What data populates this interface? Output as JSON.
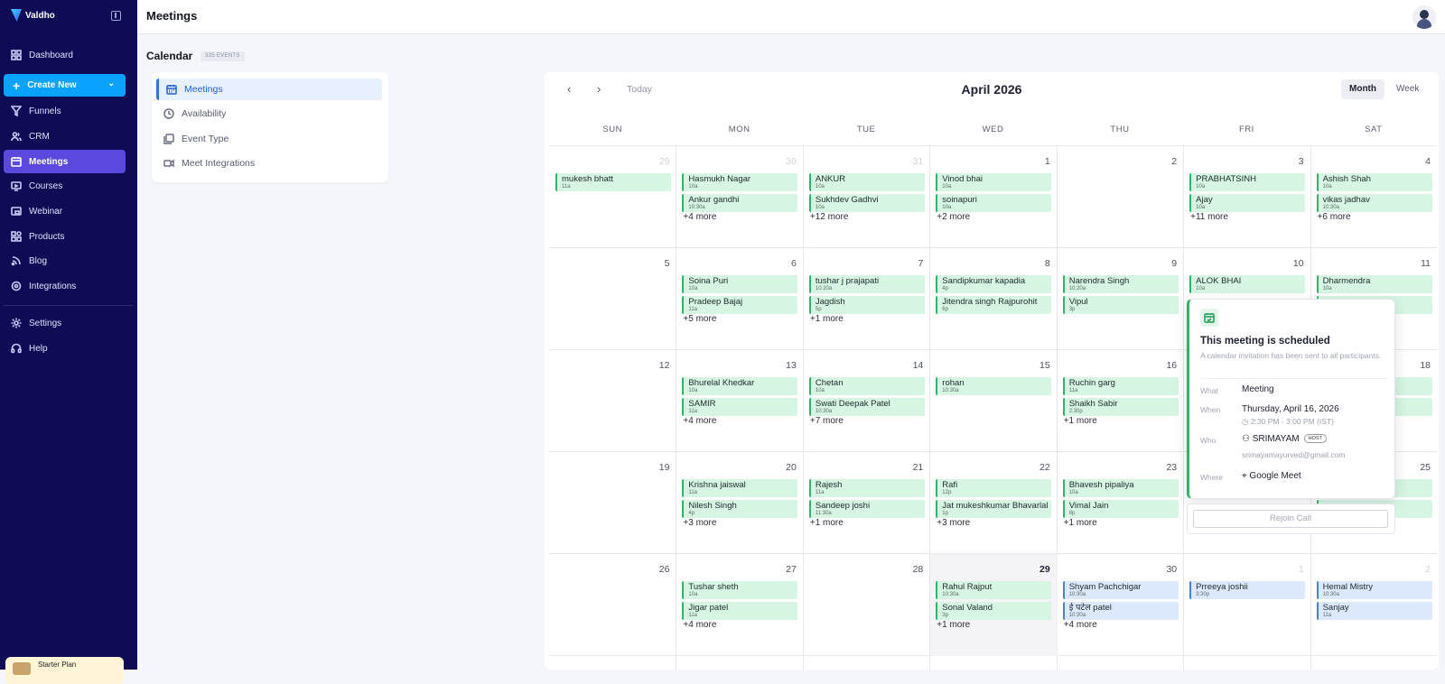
{
  "app": {
    "name": "Valdho"
  },
  "sidebar": {
    "items": [
      {
        "label": "Dashboard",
        "icon": "grid-icon"
      },
      {
        "label": "Funnels",
        "icon": "funnel-icon"
      },
      {
        "label": "CRM",
        "icon": "users-icon"
      },
      {
        "label": "Meetings",
        "icon": "calendar-icon",
        "active": true
      },
      {
        "label": "Courses",
        "icon": "courses-icon"
      },
      {
        "label": "Webinar",
        "icon": "webinar-icon"
      },
      {
        "label": "Products",
        "icon": "products-icon"
      },
      {
        "label": "Blog",
        "icon": "rss-icon"
      },
      {
        "label": "Integrations",
        "icon": "integrations-icon"
      },
      {
        "label": "Settings",
        "icon": "gear-icon"
      },
      {
        "label": "Help",
        "icon": "headset-icon"
      }
    ],
    "create_label": "Create New",
    "promo_label": "Starter Plan"
  },
  "header": {
    "title": "Meetings"
  },
  "calendar_section": {
    "title": "Calendar",
    "badge": "335 EVENTS"
  },
  "subnav": [
    {
      "label": "Meetings",
      "icon": "calendar-icon",
      "active": true
    },
    {
      "label": "Availability",
      "icon": "clock-icon"
    },
    {
      "label": "Event Type",
      "icon": "layers-icon"
    },
    {
      "label": "Meet Integrations",
      "icon": "video-icon"
    }
  ],
  "calendar": {
    "today_label": "Today",
    "month_title": "April 2026",
    "view_month": "Month",
    "view_week": "Week",
    "prev_icon": "chevron-left-icon",
    "next_icon": "chevron-right-icon",
    "days": [
      "SUN",
      "MON",
      "TUE",
      "WED",
      "THU",
      "FRI",
      "SAT"
    ],
    "weeks": [
      [
        {
          "d": "29",
          "m": true,
          "ev": [
            {
              "n": "mukesh bhatt",
              "t": "11a"
            }
          ]
        },
        {
          "d": "30",
          "m": true,
          "ev": [
            {
              "n": "Hasmukh Nagar",
              "t": "10a"
            },
            {
              "n": "Ankur gandhi",
              "t": "10:30a"
            }
          ],
          "more": "+4 more"
        },
        {
          "d": "31",
          "m": true,
          "ev": [
            {
              "n": "ANKUR",
              "t": "10a"
            },
            {
              "n": "Sukhdev Gadhvi",
              "t": "10a"
            }
          ],
          "more": "+12 more"
        },
        {
          "d": "1",
          "ev": [
            {
              "n": "Vinod bhai",
              "t": "10a"
            },
            {
              "n": "soinapuri",
              "t": "10a"
            }
          ],
          "more": "+2 more"
        },
        {
          "d": "2",
          "ev": []
        },
        {
          "d": "3",
          "ev": [
            {
              "n": "PRABHATSINH",
              "t": "10a"
            },
            {
              "n": "Ajay",
              "t": "10a"
            }
          ],
          "more": "+11 more"
        },
        {
          "d": "4",
          "ev": [
            {
              "n": "Ashish Shah",
              "t": "10a"
            },
            {
              "n": "vikas jadhav",
              "t": "10:30a"
            }
          ],
          "more": "+6 more"
        }
      ],
      [
        {
          "d": "5",
          "ev": []
        },
        {
          "d": "6",
          "ev": [
            {
              "n": "Soina Puri",
              "t": "10a"
            },
            {
              "n": "Pradeep Bajaj",
              "t": "11a"
            }
          ],
          "more": "+5 more"
        },
        {
          "d": "7",
          "ev": [
            {
              "n": "tushar j prajapati",
              "t": "10:20a"
            },
            {
              "n": "Jagdish",
              "t": "5p"
            }
          ],
          "more": "+1 more"
        },
        {
          "d": "8",
          "ev": [
            {
              "n": "Sandipkumar kapadia",
              "t": "4p"
            },
            {
              "n": "Jitendra singh Rajpurohit",
              "t": "6p"
            }
          ]
        },
        {
          "d": "9",
          "ev": [
            {
              "n": "Narendra Singh",
              "t": "10:20a"
            },
            {
              "n": "Vipul",
              "t": "3p"
            }
          ]
        },
        {
          "d": "10",
          "ev": [
            {
              "n": "ALOK BHAI",
              "t": "10a"
            }
          ]
        },
        {
          "d": "11",
          "ev": [
            {
              "n": "Dharmendra",
              "t": "10a"
            },
            {
              "n": "",
              "t": ""
            }
          ]
        }
      ],
      [
        {
          "d": "12",
          "ev": []
        },
        {
          "d": "13",
          "ev": [
            {
              "n": "Bhurelal Khedkar",
              "t": "10a"
            },
            {
              "n": "SAMIR",
              "t": "11a"
            }
          ],
          "more": "+4 more"
        },
        {
          "d": "14",
          "ev": [
            {
              "n": "Chetan",
              "t": "10a"
            },
            {
              "n": "Swati Deepak Patel",
              "t": "10:30a"
            }
          ],
          "more": "+7 more"
        },
        {
          "d": "15",
          "ev": [
            {
              "n": "rohan",
              "t": "10:30a"
            }
          ]
        },
        {
          "d": "16",
          "ev": [
            {
              "n": "Ruchin garg",
              "t": "11a"
            },
            {
              "n": "Shaikh Sabir",
              "t": "2:30p"
            }
          ],
          "more": "+1 more"
        },
        {
          "d": "17",
          "ev": []
        },
        {
          "d": "18",
          "ev": [
            {
              "n": "",
              "t": ""
            },
            {
              "n": "",
              "t": ""
            }
          ]
        }
      ],
      [
        {
          "d": "19",
          "ev": []
        },
        {
          "d": "20",
          "ev": [
            {
              "n": "Krishna jaiswal",
              "t": "11a"
            },
            {
              "n": "Nilesh Singh",
              "t": "4p"
            }
          ],
          "more": "+3 more"
        },
        {
          "d": "21",
          "ev": [
            {
              "n": "Rajesh",
              "t": "11a"
            },
            {
              "n": "Sandeep joshi",
              "t": "11:30a"
            }
          ],
          "more": "+1 more"
        },
        {
          "d": "22",
          "ev": [
            {
              "n": "Rafi",
              "t": "12p"
            },
            {
              "n": "Jat mukeshkumar Bhavarlal",
              "t": "1p"
            }
          ],
          "more": "+3 more"
        },
        {
          "d": "23",
          "ev": [
            {
              "n": "Bhavesh pipaliya",
              "t": "10a"
            },
            {
              "n": "Vimal Jain",
              "t": "8p"
            }
          ],
          "more": "+1 more"
        },
        {
          "d": "24",
          "ev": []
        },
        {
          "d": "25",
          "ev": [
            {
              "n": "",
              "t": ""
            },
            {
              "n": "",
              "t": ""
            }
          ]
        }
      ],
      [
        {
          "d": "26",
          "ev": []
        },
        {
          "d": "27",
          "ev": [
            {
              "n": "Tushar sheth",
              "t": "10a"
            },
            {
              "n": "Jigar patel",
              "t": "11a"
            }
          ],
          "more": "+4 more"
        },
        {
          "d": "28",
          "ev": []
        },
        {
          "d": "29",
          "today": true,
          "ev": [
            {
              "n": "Rahul Rajput",
              "t": "10:30a"
            },
            {
              "n": "Sonal Valand",
              "t": "3p"
            }
          ],
          "more": "+1 more"
        },
        {
          "d": "30",
          "ev": [
            {
              "n": "Shyam Pachchigar",
              "t": "10:30a",
              "b": true
            },
            {
              "n": "ई पटेल patel",
              "t": "10:30a",
              "b": true
            }
          ],
          "more": "+4 more"
        },
        {
          "d": "1",
          "m": true,
          "ev": [
            {
              "n": "Prreeya joshii",
              "t": "3:30p",
              "b": true
            }
          ]
        },
        {
          "d": "2",
          "m": true,
          "ev": [
            {
              "n": "Hemal Mistry",
              "t": "10:30a",
              "b": true
            },
            {
              "n": "Sanjay",
              "t": "11a",
              "b": true
            }
          ]
        }
      ]
    ]
  },
  "popover": {
    "title": "This meeting is scheduled",
    "subtitle": "A calendar invitation has been sent to all participants.",
    "what_label": "What",
    "what": "Meeting",
    "when_label": "When",
    "when": "Thursday, April 16, 2026",
    "when_time": "2:30 PM - 3:00 PM (IST)",
    "who_label": "Who",
    "who": "SRIMAYAM",
    "host_badge": "HOST",
    "who_email": "srimayamayurved@gmail.com",
    "where_label": "Where",
    "where": "Google Meet",
    "rejoin_label": "Rejoin Call"
  }
}
